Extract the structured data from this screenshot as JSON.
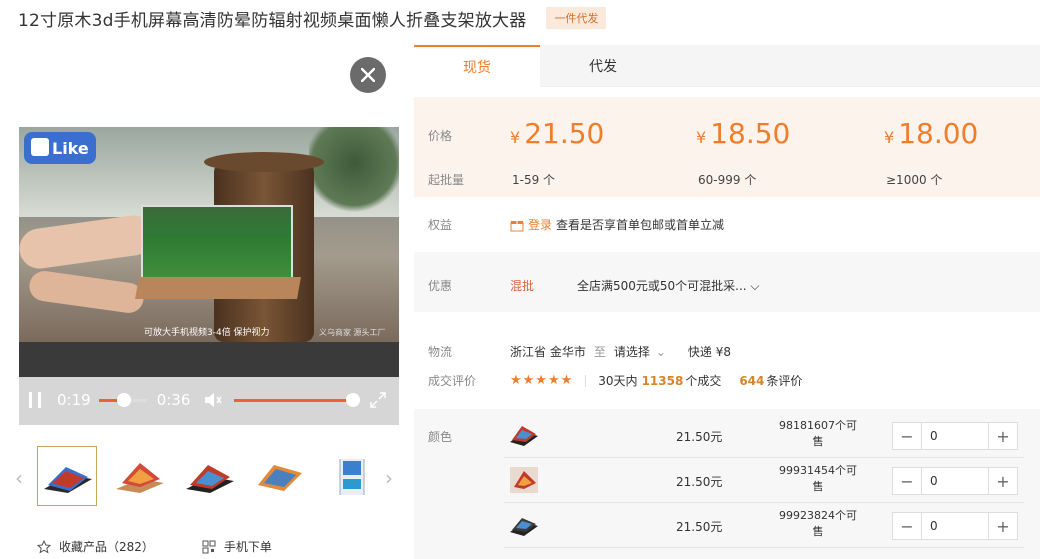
{
  "product": {
    "title": "12寸原木3d手机屏幕高清防晕防辐射视频桌面懒人折叠支架放大器",
    "tag": "一件代发"
  },
  "video": {
    "like_badge": "Like",
    "caption": "可放大手机视频3-4倍 保护视力",
    "watermark": "义乌商家 源头工厂",
    "current_time": "0:19",
    "duration": "0:36",
    "progress": 0.53,
    "volume": 1.0
  },
  "thumbnails": {
    "count": 6,
    "active_index": 0
  },
  "bottom_links": {
    "favorite": "收藏产品（282）",
    "mobile_order": "手机下单"
  },
  "tabs": [
    {
      "label": "现货",
      "active": true
    },
    {
      "label": "代发",
      "active": false
    }
  ],
  "pricing": {
    "price_label": "价格",
    "moq_label": "起批量",
    "currency": "¥",
    "tiers": [
      {
        "price": "21.50",
        "qty": "1-59 个"
      },
      {
        "price": "18.50",
        "qty": "60-999 个"
      },
      {
        "price": "18.00",
        "qty": "≥1000 个"
      }
    ]
  },
  "benefits": {
    "label": "权益",
    "login": "登录",
    "text": "查看是否享首单包邮或首单立减"
  },
  "promo": {
    "label": "优惠",
    "tag": "混批",
    "text": "全店满500元或50个可混批采... ⌵"
  },
  "logistics": {
    "label": "物流",
    "origin": "浙江省 金华市",
    "to": "至",
    "destination": "请选择",
    "shipping": "快递 ¥8"
  },
  "reviews": {
    "label": "成交评价",
    "stars": "★★★★★",
    "prefix": "30天内",
    "sold": "11358",
    "sold_suffix": "个成交",
    "review_count": "644",
    "review_suffix": "条评价"
  },
  "sku": {
    "label": "颜色",
    "rows": [
      {
        "price": "21.50元",
        "stock": "98181607个可售",
        "qty": "0"
      },
      {
        "price": "21.50元",
        "stock": "99931454个可售",
        "qty": "0"
      },
      {
        "price": "21.50元",
        "stock": "99923824个可售",
        "qty": "0"
      }
    ]
  },
  "colors": {
    "accent": "#f07d2b",
    "price_bg": "#fbf3ec"
  }
}
